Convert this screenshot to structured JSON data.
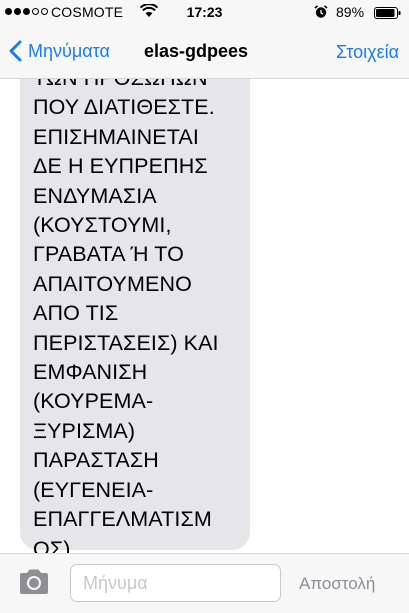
{
  "status_bar": {
    "carrier": "COSMOTE",
    "time": "17:23",
    "battery": "89%",
    "signal_bars_filled": 3,
    "signal_bars_total": 5
  },
  "nav": {
    "back_label": "Μηνύματα",
    "title": "elas-gdpees",
    "details_label": "Στοιχεία"
  },
  "message": {
    "lines": [
      "ΤΩΝ ΠΡΟΣΩΠΩΝ",
      "ΠΟΥ ΔΙΑΤΙΘΕΣΤΕ.",
      "ΕΠΙΣΗΜΑΙΝΕΤΑΙ",
      "ΔΕ Η ΕΥΠΡΕΠΗΣ",
      "ΕΝΔΥΜΑΣΙΑ",
      "(ΚΟΥΣΤΟΥΜΙ,",
      "ΓΡΑΒΑΤΑ Ή ΤΟ",
      "ΑΠΑΙΤΟΥΜΕΝΟ",
      "ΑΠΟ ΤΙΣ",
      "ΠΕΡΙΣΤΑΣΕΙΣ) ΚΑΙ",
      "ΕΜΦΑΝΙΣΗ",
      "(ΚΟΥΡΕΜΑ-",
      "ΞΥΡΙΣΜΑ)",
      "ΠΑΡΑΣΤΑΣΗ",
      "(ΕΥΓΕΝΕΙΑ-",
      "ΕΠΑΓΓΕΛΜΑΤΙΣΜ",
      "ΟΣ)."
    ]
  },
  "input": {
    "placeholder": "Μήνυμα",
    "value": "",
    "send_label": "Αποστολή"
  },
  "icons": {
    "wifi": "wifi-icon",
    "alarm": "alarm-icon",
    "battery": "battery-icon",
    "back": "chevron-left-icon",
    "camera": "camera-icon"
  },
  "colors": {
    "accent": "#1a7cf5",
    "bubble": "#e5e5ea",
    "bar_background": "#f7f7f7",
    "send_disabled": "#8e8e93"
  }
}
